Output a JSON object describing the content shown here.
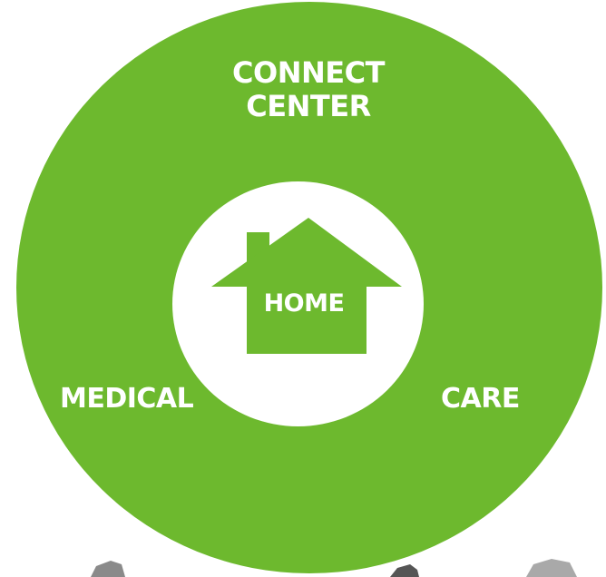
{
  "diagram": {
    "outer_labels": {
      "top_line1": "CONNECT",
      "top_line2": "CENTER",
      "left": "MEDICAL",
      "right": "CARE"
    },
    "center_label": "HOME",
    "icon": "house-icon",
    "colors": {
      "ring": "#6db92e",
      "center": "#ffffff",
      "text": "#ffffff"
    }
  }
}
